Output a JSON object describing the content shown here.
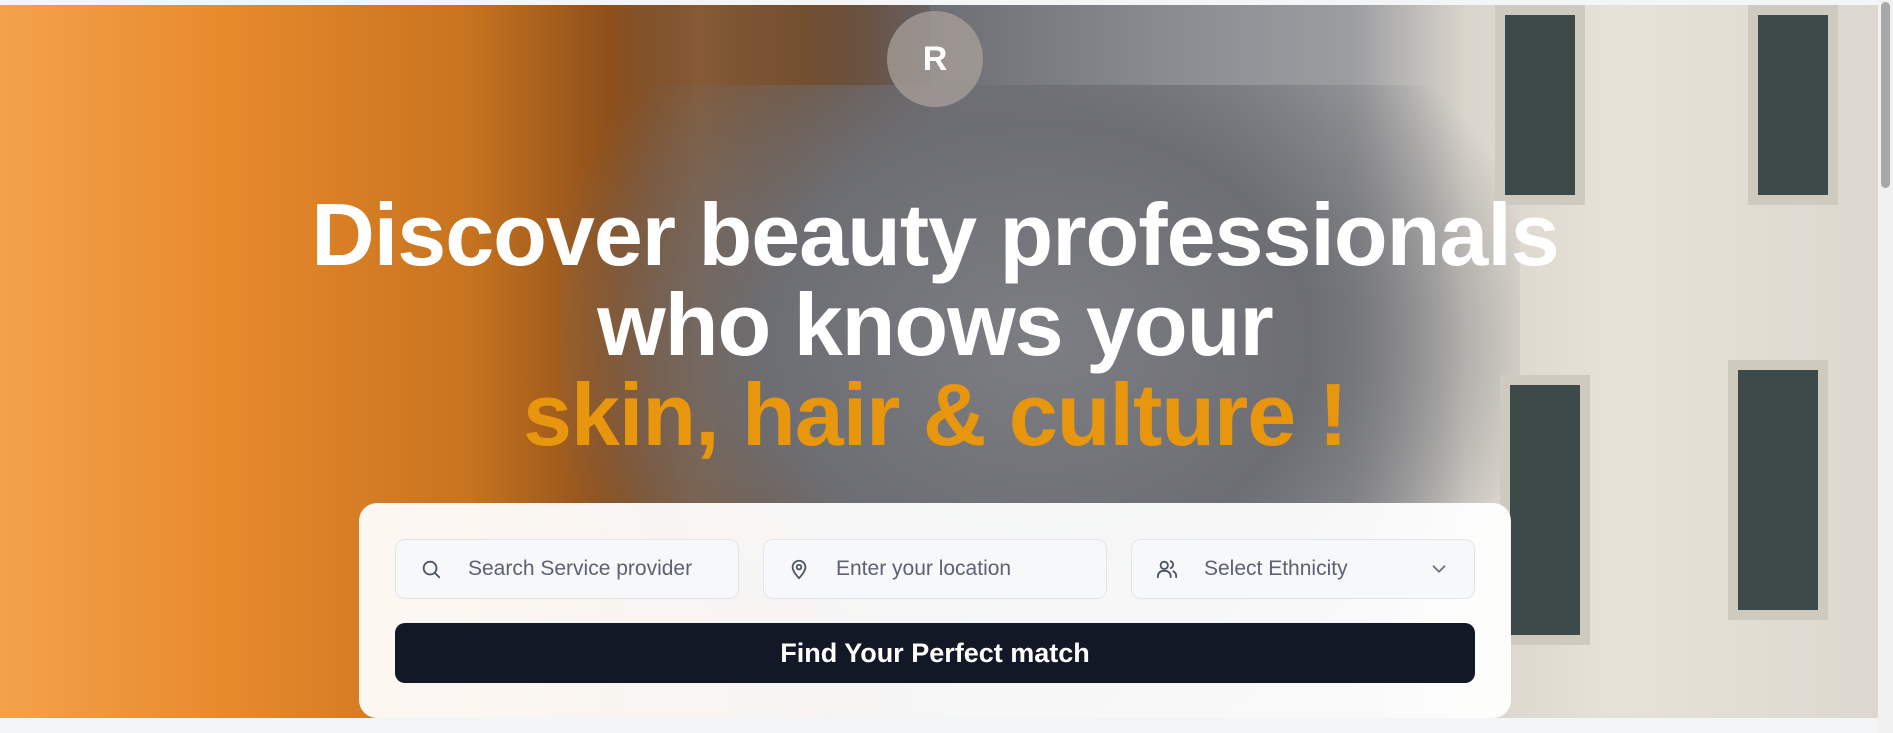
{
  "logo": {
    "letter": "R"
  },
  "hero": {
    "line1": "Discover beauty professionals",
    "line2": "who knows your",
    "line3": "skin, hair & culture !"
  },
  "search": {
    "service_placeholder": "Search Service provider",
    "location_placeholder": "Enter your location",
    "ethnicity_selected": "Select Ethnicity",
    "submit_label": "Find Your Perfect match"
  },
  "icons": {
    "service": "search-icon",
    "location": "map-pin-icon",
    "ethnicity": "users-icon",
    "dropdown": "chevron-down-icon"
  },
  "colors": {
    "accent": "#e8960e",
    "button": "#121826"
  }
}
